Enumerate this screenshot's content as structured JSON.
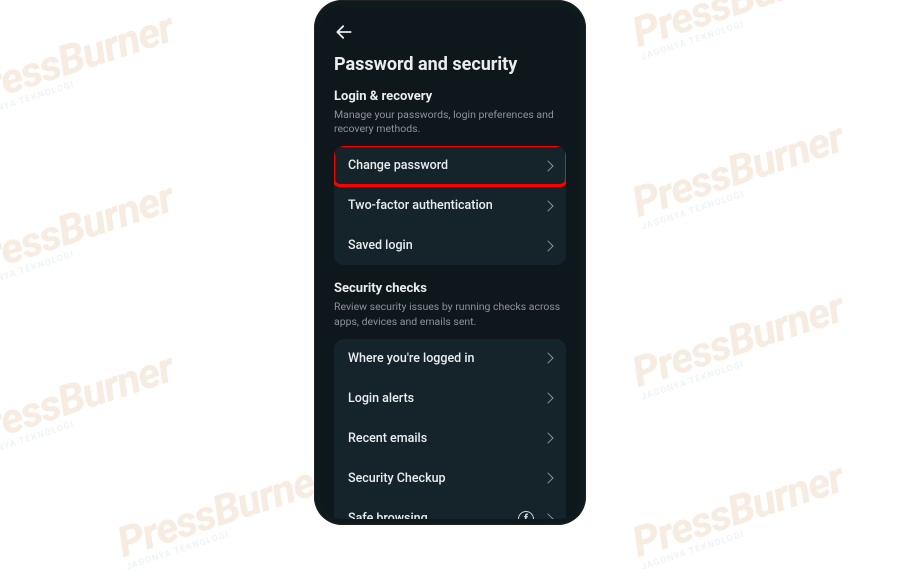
{
  "watermark": {
    "brand": "PressBurner",
    "tag": "JAGONYA TEKNOLOGI"
  },
  "header": {
    "title": "Password and security"
  },
  "sections": {
    "login": {
      "title": "Login & recovery",
      "subtitle": "Manage your passwords, login preferences and recovery methods.",
      "items": {
        "change_password": "Change password",
        "two_factor": "Two-factor authentication",
        "saved_login": "Saved login"
      }
    },
    "checks": {
      "title": "Security checks",
      "subtitle": "Review security issues by running checks across apps, devices and emails sent.",
      "items": {
        "where_logged": "Where you're logged in",
        "login_alerts": "Login alerts",
        "recent_emails": "Recent emails",
        "security_checkup": "Security Checkup",
        "safe_browsing": "Safe browsing"
      }
    }
  }
}
